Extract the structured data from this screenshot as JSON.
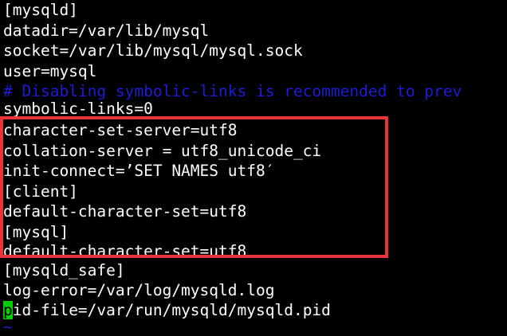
{
  "terminal": {
    "lines": [
      "[mysqld]",
      "datadir=/var/lib/mysql",
      "socket=/var/lib/mysql/mysql.sock",
      "user=mysql",
      "# Disabling symbolic-links is recommended to prev",
      "symbolic-links=0",
      "character-set-server=utf8",
      "collation-server = utf8_unicode_ci",
      "init-connect=’SET NAMES utf8′",
      "[client]",
      "default-character-set=utf8",
      "[mysql]",
      "default-character-set=utf8",
      "[mysqld_safe]",
      "log-error=/var/log/mysqld.log",
      "id-file=/var/run/mysqld/mysqld.pid",
      "~"
    ],
    "cursor_char": "p"
  },
  "colors": {
    "background": "#000000",
    "text": "#ffffff",
    "comment": "#1c1cd6",
    "cursor": "#00d000",
    "highlight_border": "#e8353a"
  }
}
